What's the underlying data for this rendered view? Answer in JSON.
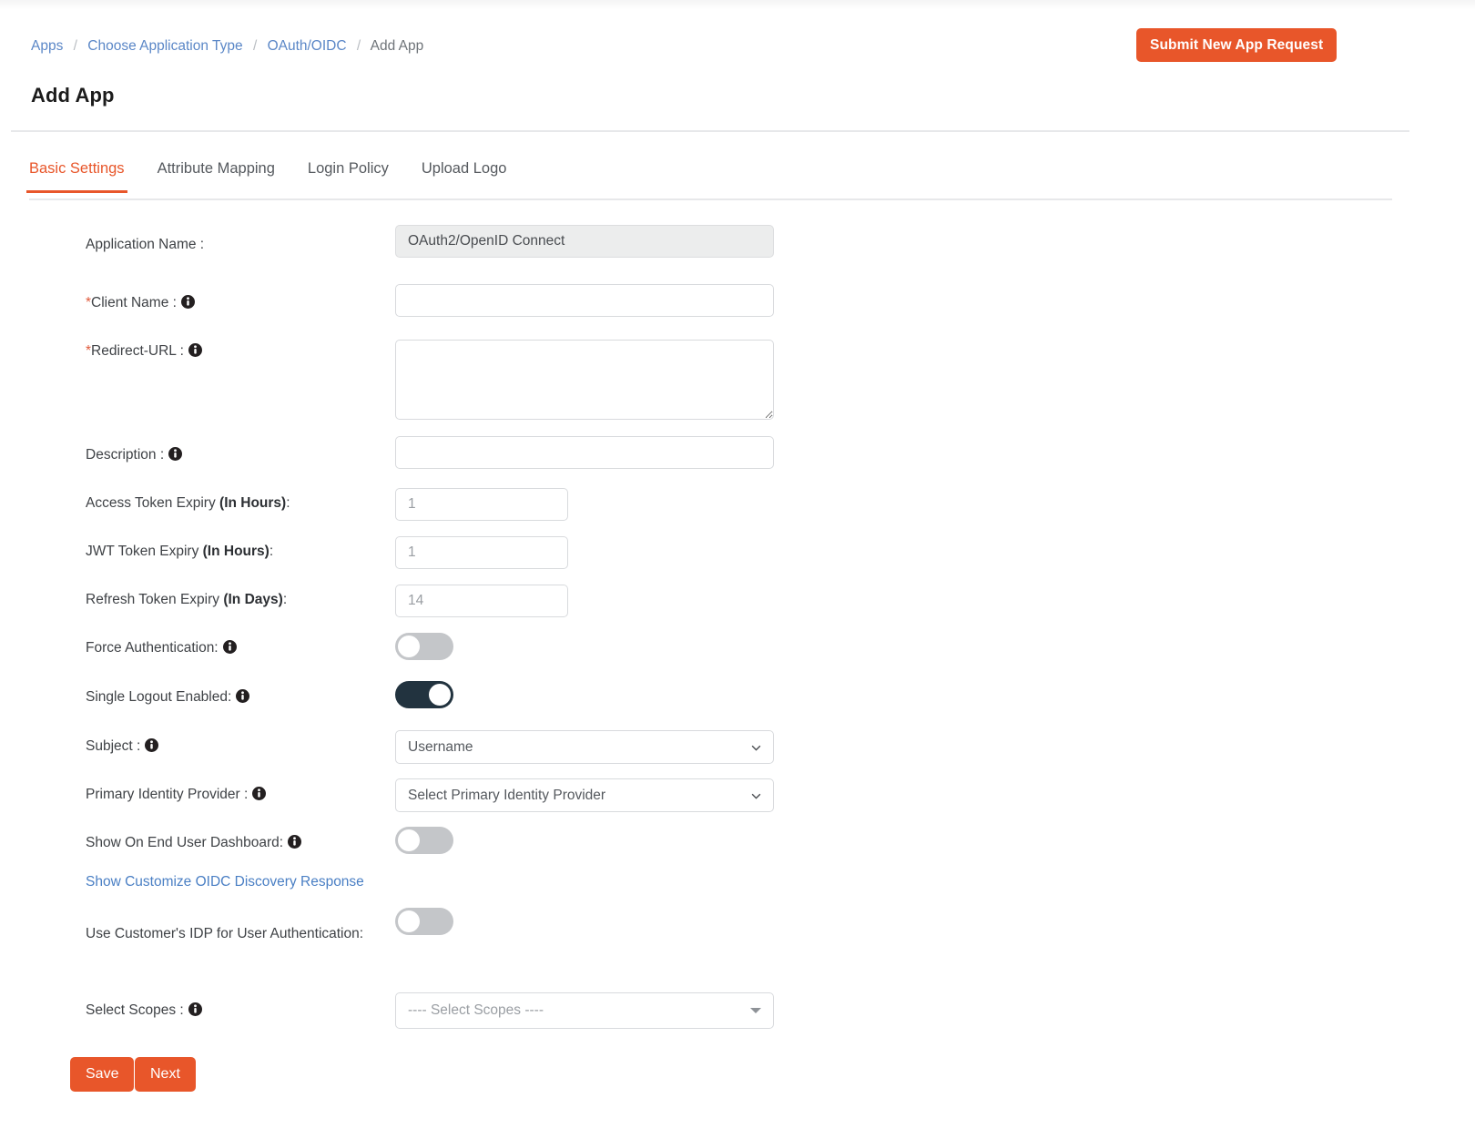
{
  "breadcrumb": {
    "items": [
      {
        "label": "Apps",
        "link": true
      },
      {
        "label": "Choose Application Type",
        "link": true
      },
      {
        "label": "OAuth/OIDC",
        "link": true
      },
      {
        "label": "Add App",
        "link": false
      }
    ],
    "separator": "/"
  },
  "header": {
    "submit_request_label": "Submit New App Request",
    "page_title": "Add App"
  },
  "tabs": [
    {
      "label": "Basic Settings",
      "active": true
    },
    {
      "label": "Attribute Mapping",
      "active": false
    },
    {
      "label": "Login Policy",
      "active": false
    },
    {
      "label": "Upload Logo",
      "active": false
    }
  ],
  "form": {
    "application_name": {
      "label": "Application Name :",
      "value": "OAuth2/OpenID Connect"
    },
    "client_name": {
      "label_required": "*",
      "label": "Client Name :",
      "value": "",
      "placeholder": ""
    },
    "redirect_url": {
      "label_required": "*",
      "label": "Redirect-URL :",
      "value": "",
      "placeholder": ""
    },
    "description": {
      "label": "Description :",
      "value": "",
      "placeholder": ""
    },
    "access_token_expiry": {
      "label": "Access Token Expiry ",
      "label_bold": "(In Hours)",
      "label_tail": ":",
      "value": "1"
    },
    "jwt_token_expiry": {
      "label": "JWT Token Expiry ",
      "label_bold": "(In Hours)",
      "label_tail": ":",
      "value": "1"
    },
    "refresh_token_expiry": {
      "label": "Refresh Token Expiry ",
      "label_bold": "(In Days)",
      "label_tail": ":",
      "value": "14"
    },
    "force_authentication": {
      "label": "Force Authentication:",
      "enabled": false
    },
    "single_logout_enabled": {
      "label": "Single Logout Enabled:",
      "enabled": true
    },
    "subject": {
      "label": "Subject :",
      "selected": "Username",
      "options": [
        "Username"
      ]
    },
    "primary_identity_provider": {
      "label": "Primary Identity Provider :",
      "selected": "Select Primary Identity Provider",
      "options": [
        "Select Primary Identity Provider"
      ]
    },
    "show_on_end_user_dashboard": {
      "label": "Show On End User Dashboard:",
      "enabled": false
    },
    "show_customize_oidc": {
      "label": "Show Customize OIDC Discovery Response"
    },
    "use_customers_idp": {
      "label": "Use Customer's IDP for User Authentication:",
      "enabled": false
    },
    "select_scopes": {
      "label": "Select Scopes :",
      "placeholder": "---- Select Scopes ----"
    }
  },
  "actions": {
    "save_label": "Save",
    "next_label": "Next"
  },
  "colors": {
    "accent": "#e8562a",
    "link": "#5b87c7",
    "toggle_on": "#22333f",
    "toggle_off": "#c4c6c9"
  },
  "icons": {
    "info": "info-icon",
    "chevron_down": "chevron-down-icon",
    "caret_down": "caret-down-icon"
  }
}
